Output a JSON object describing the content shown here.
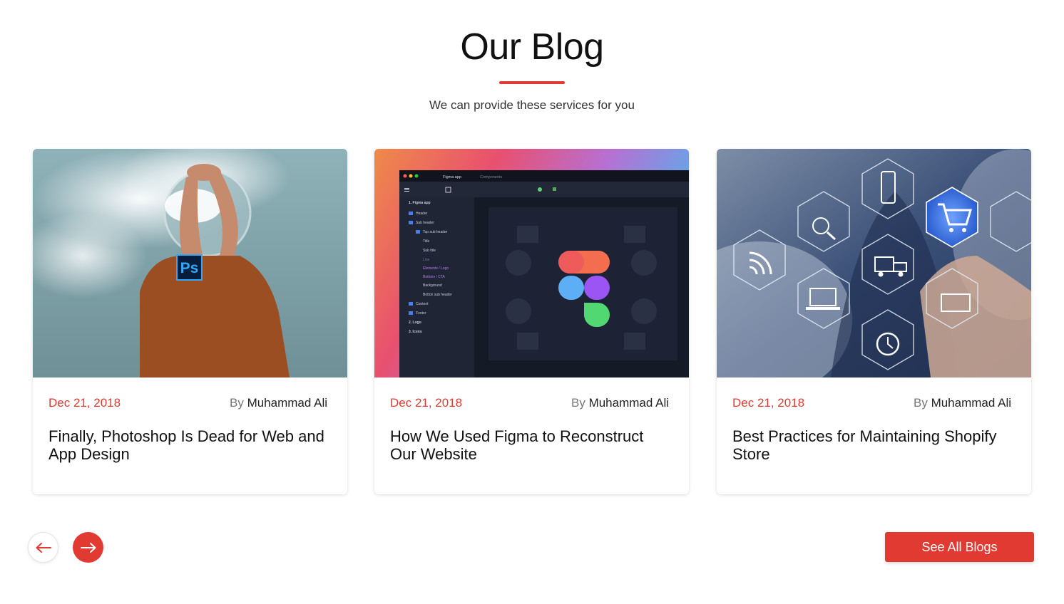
{
  "section": {
    "title": "Our Blog",
    "subtitle": "We can provide these services for you",
    "accent_color": "#e03a32"
  },
  "posts": [
    {
      "date": "Dec 21, 2018",
      "by_label": "By",
      "author": "Muhammad Ali",
      "title": "Finally, Photoshop Is Dead for Web and App Design",
      "image_badge": "Ps"
    },
    {
      "date": "Dec 21, 2018",
      "by_label": "By",
      "author": "Muhammad Ali",
      "title": "How We Used Figma to Reconstruct Our Website",
      "figma_ui": {
        "tabs": [
          "Figma app",
          "Components"
        ],
        "layers": [
          "1. Figma app",
          "Header",
          "Sub header",
          "Top sub header",
          "Title",
          "Sub title",
          "Line",
          "Elements / Logo",
          "Buttons / CTA",
          "Background",
          "Botton sub header",
          "Content",
          "Footer",
          "2. Logo",
          "3. Icons"
        ]
      }
    },
    {
      "date": "Dec 21, 2018",
      "by_label": "By",
      "author": "Muhammad Ali",
      "title": "Best Practices for Maintaining Shopify Store"
    }
  ],
  "navigation": {
    "prev_icon": "arrow-left-icon",
    "next_icon": "arrow-right-icon"
  },
  "cta": {
    "label": "See All Blogs"
  }
}
